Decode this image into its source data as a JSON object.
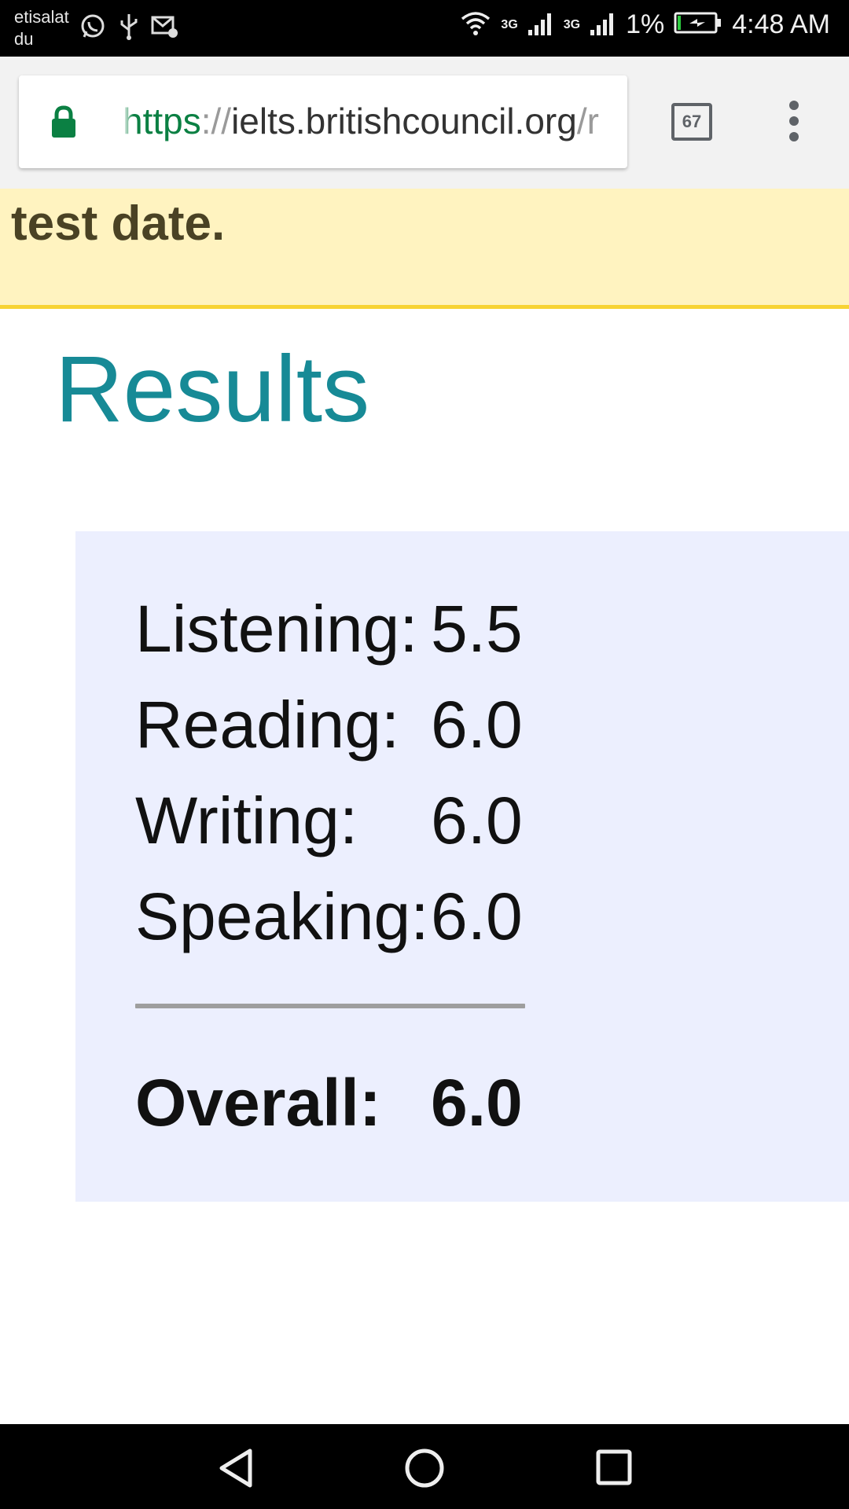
{
  "status_bar": {
    "carrier_line1": "etisalat",
    "carrier_line2": "du",
    "network1": "3G",
    "network2": "3G",
    "battery": "1%",
    "time": "4:48 AM",
    "icons_left": [
      "whatsapp-icon",
      "usb-icon",
      "mail-settings-icon"
    ],
    "icons_right": [
      "wifi-icon",
      "signal-icon",
      "signal-icon",
      "battery-charging-icon"
    ]
  },
  "browser": {
    "url_scheme": "https",
    "url_sep": "://",
    "url_host": "ielts.britishcouncil.org",
    "url_path": "/r",
    "tab_count": "67"
  },
  "notice": {
    "text": "test date."
  },
  "results": {
    "title": "Results",
    "rows": [
      {
        "label": "Listening:",
        "score": "5.5"
      },
      {
        "label": "Reading:",
        "score": "6.0"
      },
      {
        "label": "Writing:",
        "score": "6.0"
      },
      {
        "label": "Speaking:",
        "score": "6.0"
      }
    ],
    "overall": {
      "label": "Overall:",
      "score": "6.0"
    }
  },
  "colors": {
    "title": "#178a96",
    "box_bg": "#eceffe",
    "notice_bg": "#fff3c0",
    "notice_border": "#f7d334",
    "secure_green": "#0b8043"
  }
}
